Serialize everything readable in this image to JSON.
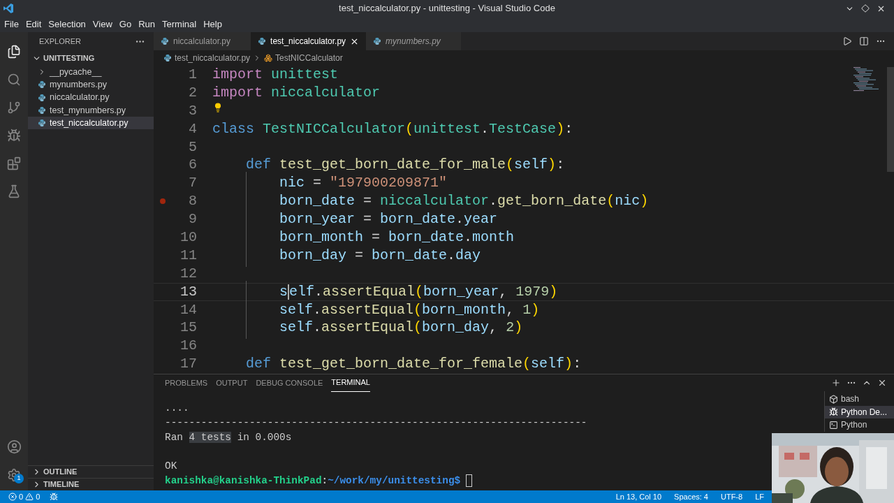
{
  "window": {
    "title": "test_niccalculator.py - unittesting - Visual Studio Code"
  },
  "menu": [
    "File",
    "Edit",
    "Selection",
    "View",
    "Go",
    "Run",
    "Terminal",
    "Help"
  ],
  "activity_bar": {
    "settings_badge": "1"
  },
  "sidebar": {
    "title": "EXPLORER",
    "folder": {
      "label": "UNITTESTING",
      "expanded": true,
      "children": [
        {
          "label": "__pycache__",
          "kind": "folder",
          "selected": false
        },
        {
          "label": "mynumbers.py",
          "kind": "file",
          "selected": false
        },
        {
          "label": "niccalculator.py",
          "kind": "file",
          "selected": false
        },
        {
          "label": "test_mynumbers.py",
          "kind": "file",
          "selected": false
        },
        {
          "label": "test_niccalculator.py",
          "kind": "file",
          "selected": true
        }
      ]
    },
    "sections": [
      {
        "label": "OUTLINE",
        "expanded": false
      },
      {
        "label": "TIMELINE",
        "expanded": false
      }
    ]
  },
  "tabs": [
    {
      "label": "niccalculator.py",
      "selected": false,
      "preview": false
    },
    {
      "label": "test_niccalculator.py",
      "selected": true,
      "preview": false
    },
    {
      "label": "mynumbers.py",
      "selected": false,
      "preview": true
    }
  ],
  "breadcrumbs": [
    "test_niccalculator.py",
    "TestNICCalculator"
  ],
  "editor": {
    "lines": [
      {
        "number": "1",
        "current": false,
        "breakpoint": false,
        "lightbulb": false,
        "tokens": [
          {
            "kind": "kw",
            "t": "import "
          },
          {
            "kind": "type",
            "t": "unittest"
          }
        ]
      },
      {
        "number": "2",
        "current": false,
        "breakpoint": false,
        "lightbulb": false,
        "tokens": [
          {
            "kind": "kw",
            "t": "import "
          },
          {
            "kind": "type",
            "t": "niccalculator"
          }
        ]
      },
      {
        "number": "3",
        "current": false,
        "breakpoint": false,
        "lightbulb": true
      },
      {
        "number": "4",
        "current": false,
        "breakpoint": false,
        "lightbulb": false,
        "tokens": [
          {
            "kind": "kw2",
            "t": "class "
          },
          {
            "kind": "type",
            "t": "TestNICCalculator"
          },
          {
            "kind": "br",
            "t": "("
          },
          {
            "kind": "type",
            "t": "unittest"
          },
          {
            "kind": "p",
            "t": "."
          },
          {
            "kind": "type",
            "t": "TestCase"
          },
          {
            "kind": "br",
            "t": ")"
          },
          {
            "kind": "p",
            "t": ":"
          }
        ]
      },
      {
        "number": "5",
        "current": false,
        "breakpoint": false,
        "lightbulb": false
      },
      {
        "number": "6",
        "current": false,
        "breakpoint": false,
        "lightbulb": false,
        "tokens": [
          {
            "kind": "kw2",
            "t": "    def "
          },
          {
            "kind": "fn",
            "t": "test_get_born_date_for_male"
          },
          {
            "kind": "br",
            "t": "("
          },
          {
            "kind": "var",
            "t": "self"
          },
          {
            "kind": "br",
            "t": ")"
          },
          {
            "kind": "p",
            "t": ":"
          }
        ]
      },
      {
        "number": "7",
        "current": false,
        "breakpoint": false,
        "lightbulb": false,
        "tokens": [
          {
            "kind": "var",
            "t": "        nic"
          },
          {
            "kind": "p",
            "t": " = "
          },
          {
            "kind": "str",
            "t": "\"197900209871\""
          }
        ]
      },
      {
        "number": "8",
        "current": false,
        "breakpoint": true,
        "lightbulb": false,
        "tokens": [
          {
            "kind": "var",
            "t": "        born_date"
          },
          {
            "kind": "p",
            "t": " = "
          },
          {
            "kind": "type",
            "t": "niccalculator"
          },
          {
            "kind": "p",
            "t": "."
          },
          {
            "kind": "fn",
            "t": "get_born_date"
          },
          {
            "kind": "br",
            "t": "("
          },
          {
            "kind": "var",
            "t": "nic"
          },
          {
            "kind": "br",
            "t": ")"
          }
        ]
      },
      {
        "number": "9",
        "current": false,
        "breakpoint": false,
        "lightbulb": false,
        "tokens": [
          {
            "kind": "var",
            "t": "        born_year"
          },
          {
            "kind": "p",
            "t": " = "
          },
          {
            "kind": "var",
            "t": "born_date"
          },
          {
            "kind": "p",
            "t": "."
          },
          {
            "kind": "var",
            "t": "year"
          }
        ]
      },
      {
        "number": "10",
        "current": false,
        "breakpoint": false,
        "lightbulb": false,
        "tokens": [
          {
            "kind": "var",
            "t": "        born_month"
          },
          {
            "kind": "p",
            "t": " = "
          },
          {
            "kind": "var",
            "t": "born_date"
          },
          {
            "kind": "p",
            "t": "."
          },
          {
            "kind": "var",
            "t": "month"
          }
        ]
      },
      {
        "number": "11",
        "current": false,
        "breakpoint": false,
        "lightbulb": false,
        "tokens": [
          {
            "kind": "var",
            "t": "        born_day"
          },
          {
            "kind": "p",
            "t": " = "
          },
          {
            "kind": "var",
            "t": "born_date"
          },
          {
            "kind": "p",
            "t": "."
          },
          {
            "kind": "var",
            "t": "day"
          }
        ]
      },
      {
        "number": "12",
        "current": false,
        "breakpoint": false,
        "lightbulb": false
      },
      {
        "number": "13",
        "current": true,
        "breakpoint": false,
        "lightbulb": false,
        "tokens": [
          {
            "kind": "var",
            "t": "        s"
          },
          {
            "kind": "cursor"
          },
          {
            "kind": "var",
            "t": "elf"
          },
          {
            "kind": "p",
            "t": "."
          },
          {
            "kind": "fn",
            "t": "assertEqual"
          },
          {
            "kind": "br",
            "t": "("
          },
          {
            "kind": "var",
            "t": "born_year"
          },
          {
            "kind": "p",
            "t": ", "
          },
          {
            "kind": "num",
            "t": "1979"
          },
          {
            "kind": "br",
            "t": ")"
          }
        ]
      },
      {
        "number": "14",
        "current": false,
        "breakpoint": false,
        "lightbulb": false,
        "tokens": [
          {
            "kind": "var",
            "t": "        self"
          },
          {
            "kind": "p",
            "t": "."
          },
          {
            "kind": "fn",
            "t": "assertEqual"
          },
          {
            "kind": "br",
            "t": "("
          },
          {
            "kind": "var",
            "t": "born_month"
          },
          {
            "kind": "p",
            "t": ", "
          },
          {
            "kind": "num",
            "t": "1"
          },
          {
            "kind": "br",
            "t": ")"
          }
        ]
      },
      {
        "number": "15",
        "current": false,
        "breakpoint": false,
        "lightbulb": false,
        "tokens": [
          {
            "kind": "var",
            "t": "        self"
          },
          {
            "kind": "p",
            "t": "."
          },
          {
            "kind": "fn",
            "t": "assertEqual"
          },
          {
            "kind": "br",
            "t": "("
          },
          {
            "kind": "var",
            "t": "born_day"
          },
          {
            "kind": "p",
            "t": ", "
          },
          {
            "kind": "num",
            "t": "2"
          },
          {
            "kind": "br",
            "t": ")"
          }
        ]
      },
      {
        "number": "16",
        "current": false,
        "breakpoint": false,
        "lightbulb": false
      },
      {
        "number": "17",
        "current": false,
        "breakpoint": false,
        "lightbulb": false,
        "tokens": [
          {
            "kind": "kw2",
            "t": "    def "
          },
          {
            "kind": "fn",
            "t": "test_get_born_date_for_female"
          },
          {
            "kind": "br",
            "t": "("
          },
          {
            "kind": "var",
            "t": "self"
          },
          {
            "kind": "br",
            "t": ")"
          },
          {
            "kind": "p",
            "t": ":"
          }
        ]
      }
    ]
  },
  "panel": {
    "tabs": [
      {
        "label": "PROBLEMS",
        "selected": false
      },
      {
        "label": "OUTPUT",
        "selected": false
      },
      {
        "label": "DEBUG CONSOLE",
        "selected": false
      },
      {
        "label": "TERMINAL",
        "selected": true
      }
    ],
    "terminal": [
      {
        "kind": "output",
        "segments": [
          {
            "t": "....",
            "highlight": false
          }
        ]
      },
      {
        "kind": "output",
        "segments": [
          {
            "t": "----------------------------------------------------------------------",
            "highlight": false
          }
        ]
      },
      {
        "kind": "output",
        "segments": [
          {
            "t": "Ran ",
            "highlight": false
          },
          {
            "t": "4 tests",
            "highlight": true
          },
          {
            "t": " in 0.000s",
            "highlight": false
          }
        ]
      },
      {
        "kind": "blank"
      },
      {
        "kind": "output",
        "segments": [
          {
            "t": "OK",
            "highlight": false
          }
        ]
      },
      {
        "kind": "prompt",
        "user": "kanishka@kanishka-ThinkPad",
        "separator": ":",
        "path": "~/work/my/unittesting",
        "symbol": "$"
      }
    ],
    "terminals": [
      {
        "label": "bash",
        "kind": "shell",
        "selected": false
      },
      {
        "label": "Python De...",
        "kind": "debug",
        "selected": true
      },
      {
        "label": "Python",
        "kind": "console",
        "selected": false
      }
    ]
  },
  "status_bar": {
    "errors": "0",
    "warnings": "0",
    "items": [
      "Ln 13, Col 10",
      "Spaces: 4",
      "UTF-8",
      "LF"
    ]
  },
  "webcam": {
    "kind": "picture"
  }
}
